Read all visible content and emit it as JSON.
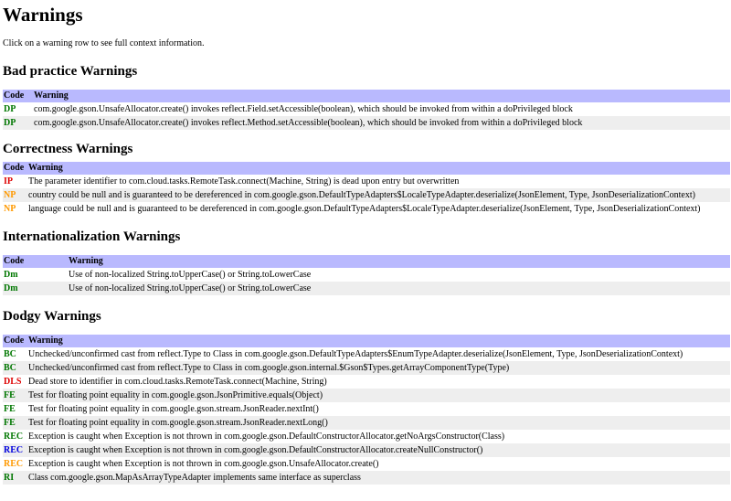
{
  "page": {
    "title": "Warnings",
    "intro": "Click on a warning row to see full context information."
  },
  "colors": {
    "header_bg": "#b9b9fe",
    "alt_row_bg": "#eeeeee",
    "green": "#007700",
    "red": "#dd0000",
    "orange": "#ff9900",
    "blue": "#0000dd"
  },
  "sections": [
    {
      "title": "Bad practice Warnings",
      "headers": {
        "code": "Code",
        "warning": "Warning"
      },
      "rows": [
        {
          "code": "DP",
          "color": "green",
          "text": "com.google.gson.UnsafeAllocator.create() invokes reflect.Field.setAccessible(boolean), which should be invoked from within a doPrivileged block"
        },
        {
          "code": "DP",
          "color": "green",
          "text": "com.google.gson.UnsafeAllocator.create() invokes reflect.Method.setAccessible(boolean), which should be invoked from within a doPrivileged block"
        }
      ]
    },
    {
      "title": "Correctness Warnings",
      "headers": {
        "code": "Code",
        "warning": "Warning"
      },
      "rows": [
        {
          "code": "IP",
          "color": "red",
          "text": "The parameter identifier to com.cloud.tasks.RemoteTask.connect(Machine, String) is dead upon entry but overwritten"
        },
        {
          "code": "NP",
          "color": "orange",
          "text": "country could be null and is guaranteed to be dereferenced in com.google.gson.DefaultTypeAdapters$LocaleTypeAdapter.deserialize(JsonElement, Type, JsonDeserializationContext)"
        },
        {
          "code": "NP",
          "color": "orange",
          "text": "language could be null and is guaranteed to be dereferenced in com.google.gson.DefaultTypeAdapters$LocaleTypeAdapter.deserialize(JsonElement, Type, JsonDeserializationContext)"
        }
      ]
    },
    {
      "title": "Internationalization Warnings",
      "headers": {
        "code": "Code",
        "warning": "Warning"
      },
      "rows": [
        {
          "code": "Dm",
          "color": "green",
          "text": "Use of non-localized String.toUpperCase() or String.toLowerCase"
        },
        {
          "code": "Dm",
          "color": "green",
          "text": "Use of non-localized String.toUpperCase() or String.toLowerCase"
        }
      ]
    },
    {
      "title": "Dodgy Warnings",
      "headers": {
        "code": "Code",
        "warning": "Warning"
      },
      "rows": [
        {
          "code": "BC",
          "color": "green",
          "text": "Unchecked/unconfirmed cast from reflect.Type to Class in com.google.gson.DefaultTypeAdapters$EnumTypeAdapter.deserialize(JsonElement, Type, JsonDeserializationContext)"
        },
        {
          "code": "BC",
          "color": "green",
          "text": "Unchecked/unconfirmed cast from reflect.Type to Class in com.google.gson.internal.$Gson$Types.getArrayComponentType(Type)"
        },
        {
          "code": "DLS",
          "color": "red",
          "text": "Dead store to identifier in com.cloud.tasks.RemoteTask.connect(Machine, String)"
        },
        {
          "code": "FE",
          "color": "green",
          "text": "Test for floating point equality in com.google.gson.JsonPrimitive.equals(Object)"
        },
        {
          "code": "FE",
          "color": "green",
          "text": "Test for floating point equality in com.google.gson.stream.JsonReader.nextInt()"
        },
        {
          "code": "FE",
          "color": "green",
          "text": "Test for floating point equality in com.google.gson.stream.JsonReader.nextLong()"
        },
        {
          "code": "REC",
          "color": "green",
          "text": "Exception is caught when Exception is not thrown in com.google.gson.DefaultConstructorAllocator.getNoArgsConstructor(Class)"
        },
        {
          "code": "REC",
          "color": "blue",
          "text": "Exception is caught when Exception is not thrown in com.google.gson.DefaultConstructorAllocator.createNullConstructor()"
        },
        {
          "code": "REC",
          "color": "orange",
          "text": "Exception is caught when Exception is not thrown in com.google.gson.UnsafeAllocator.create()"
        },
        {
          "code": "RI",
          "color": "green",
          "text": "Class com.google.gson.MapAsArrayTypeAdapter implements same interface as superclass"
        }
      ]
    }
  ]
}
